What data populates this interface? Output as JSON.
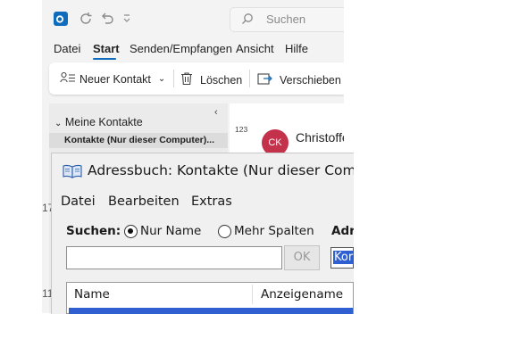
{
  "outlook": {
    "search_placeholder": "Suchen",
    "menu": [
      "Datei",
      "Start",
      "Senden/Empfangen",
      "Ansicht",
      "Hilfe"
    ],
    "ribbon": {
      "new_contact": "Neuer Kontakt",
      "delete": "Löschen",
      "move": "Verschieben"
    },
    "sidebar": {
      "group": "Meine Kontakte",
      "selected": "Kontakte (Nur dieser Computer)...",
      "side_num_1": "17",
      "side_num_2": "11"
    },
    "list": {
      "header": "123",
      "avatar_initials": "CK",
      "contact_name": "Christoffe"
    }
  },
  "dialog": {
    "title": "Adressbuch: Kontakte (Nur dieser Compute",
    "menu": [
      "Datei",
      "Bearbeiten",
      "Extras"
    ],
    "search_label": "Suchen:",
    "radio_name": "Nur Name",
    "radio_more": "Mehr Spalten",
    "addr_label": "Adr",
    "search_value": "",
    "ok": "OK",
    "book_value": "Kor",
    "columns": [
      "Name",
      "Anzeigename"
    ]
  },
  "colors": {
    "accent": "#0f6cbd",
    "avatar": "#c4314b",
    "selection": "#2f5fd0"
  }
}
